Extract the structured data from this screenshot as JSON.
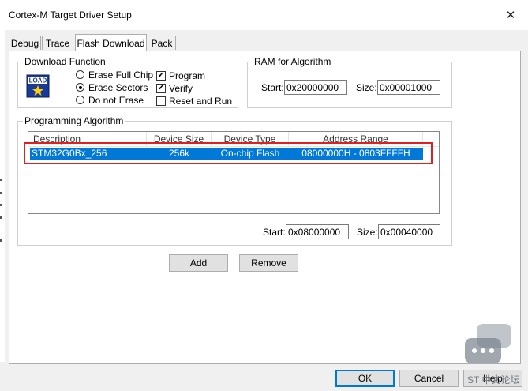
{
  "window": {
    "title": "Cortex-M Target Driver Setup",
    "close_glyph": "✕"
  },
  "tabs": [
    "Debug",
    "Trace",
    "Flash Download",
    "Pack"
  ],
  "active_tab": "Flash Download",
  "download_function": {
    "legend": "Download Function",
    "icon_text": "LOAD",
    "radios": [
      {
        "label": "Erase Full Chip",
        "selected": false
      },
      {
        "label": "Erase Sectors",
        "selected": true
      },
      {
        "label": "Do not Erase",
        "selected": false
      }
    ],
    "checks": [
      {
        "label": "Program",
        "checked": true
      },
      {
        "label": "Verify",
        "checked": true
      },
      {
        "label": "Reset and Run",
        "checked": false
      }
    ]
  },
  "ram": {
    "legend": "RAM for Algorithm",
    "start_label": "Start:",
    "start_value": "0x20000000",
    "size_label": "Size:",
    "size_value": "0x00001000"
  },
  "programming": {
    "legend": "Programming Algorithm",
    "columns": [
      "Description",
      "Device Size",
      "Device Type",
      "Address Range"
    ],
    "rows": [
      {
        "description": "STM32G0Bx_256",
        "size": "256k",
        "type": "On-chip Flash",
        "range": "08000000H - 0803FFFFH"
      }
    ],
    "start_label": "Start:",
    "start_value": "0x08000000",
    "size_label": "Size:",
    "size_value": "0x00040000"
  },
  "buttons": {
    "add": "Add",
    "remove": "Remove",
    "ok": "OK",
    "cancel": "Cancel",
    "help": "Help"
  },
  "watermark": {
    "text": "ST 中文论坛"
  },
  "colors": {
    "selection": "#0078d7",
    "highlight_box": "#e02020"
  },
  "icons": {
    "close": "close-icon",
    "load": "load-icon",
    "watermark": "chat-bubble-icon"
  }
}
